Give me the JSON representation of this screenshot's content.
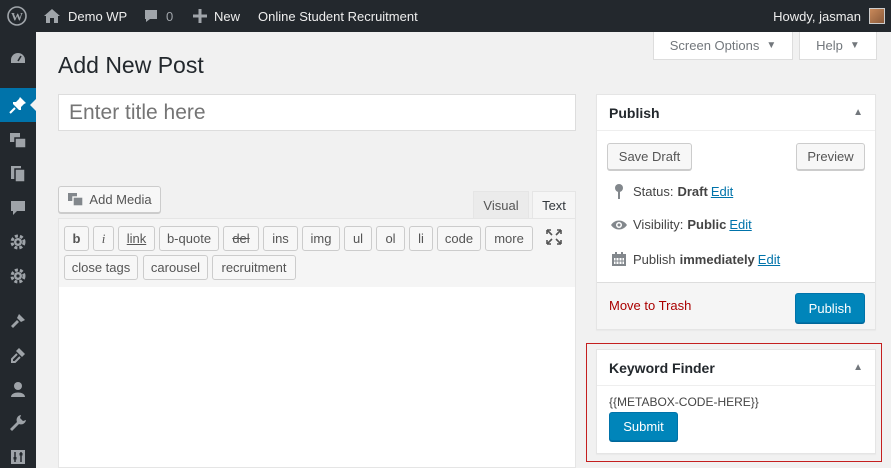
{
  "adminbar": {
    "site_name": "Demo WP",
    "comments_count": "0",
    "new_label": "New",
    "plugin_link": "Online Student Recruitment",
    "howdy": "Howdy, jasman"
  },
  "header": {
    "screen_options": "Screen Options",
    "help": "Help",
    "page_title": "Add New Post"
  },
  "editor": {
    "title_placeholder": "Enter title here",
    "add_media": "Add Media",
    "tab_visual": "Visual",
    "tab_text": "Text",
    "quicktags": [
      "b",
      "i",
      "link",
      "b-quote",
      "del",
      "ins",
      "img",
      "ul",
      "ol",
      "li",
      "code",
      "more"
    ],
    "quicktags_row2": [
      "close tags",
      "carousel",
      "recruitment"
    ]
  },
  "publish": {
    "title": "Publish",
    "save_draft": "Save Draft",
    "preview": "Preview",
    "status_label": "Status:",
    "status_value": "Draft",
    "visibility_label": "Visibility:",
    "visibility_value": "Public",
    "publish_label": "Publish",
    "publish_value": "immediately",
    "edit": "Edit",
    "trash": "Move to Trash",
    "publish_button": "Publish"
  },
  "keyword_finder": {
    "title": "Keyword Finder",
    "code": "{{METABOX-CODE-HERE}}",
    "submit": "Submit"
  },
  "colors": {
    "accent": "#0085ba",
    "adminbar": "#23282d",
    "highlight_border": "#c41f1f"
  }
}
